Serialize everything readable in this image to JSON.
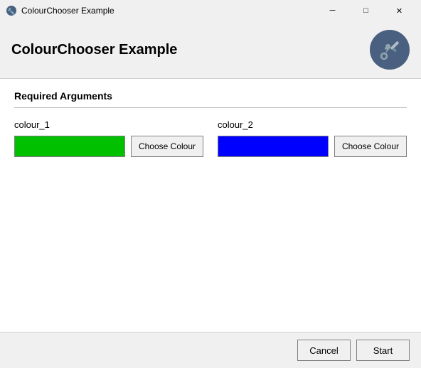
{
  "titleBar": {
    "icon": "🔧",
    "title": "ColourChooser Example",
    "minimizeLabel": "─",
    "maximizeLabel": "□",
    "closeLabel": "✕"
  },
  "header": {
    "title": "ColourChooser Example"
  },
  "content": {
    "sectionTitle": "Required Arguments",
    "colour1": {
      "label": "colour_1",
      "swatchColor": "#00c000",
      "buttonLabel": "Choose Colour"
    },
    "colour2": {
      "label": "colour_2",
      "swatchColor": "#0000ff",
      "buttonLabel": "Choose Colour"
    }
  },
  "footer": {
    "cancelLabel": "Cancel",
    "startLabel": "Start"
  }
}
